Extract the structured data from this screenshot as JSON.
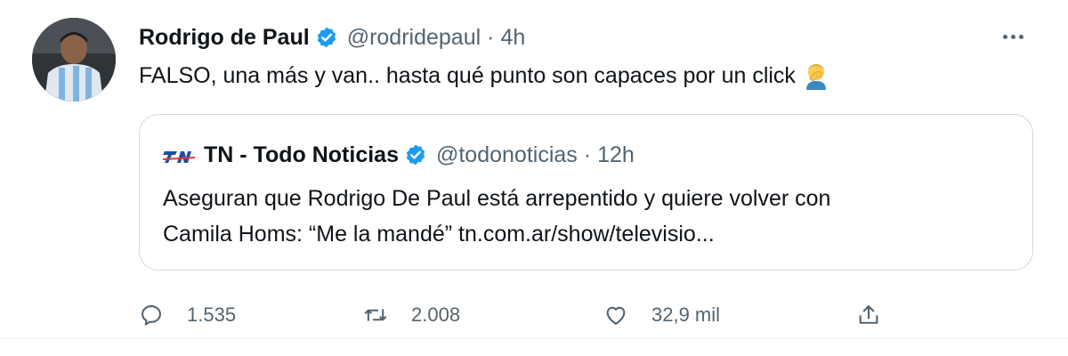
{
  "author": {
    "name": "Rodrigo de Paul",
    "handle": "@rodridepaul",
    "separator": "·",
    "time": "4h",
    "avatar_icon": "player-avatar"
  },
  "tweet": {
    "text": "FALSO, una más y van.. hasta qué punto son capaces por un click",
    "emoji_icon": "facepalm-emoji"
  },
  "quoted": {
    "logo_icon": "tn-logo",
    "name": "TN - Todo Noticias",
    "handle": "@todonoticias",
    "separator": "·",
    "time": "12h",
    "text_line1": "Aseguran que Rodrigo De Paul está arrepentido y quiere volver con",
    "text_line2": "Camila Homs: “Me la mandé” tn.com.ar/show/televisio..."
  },
  "actions": {
    "replies": "1.535",
    "retweets": "2.008",
    "likes": "32,9 mil"
  },
  "colors": {
    "verified": "#1d9bf0",
    "secondary_text": "#536471",
    "border": "#cfd9de",
    "tn_logo": "#1d4fa0"
  }
}
